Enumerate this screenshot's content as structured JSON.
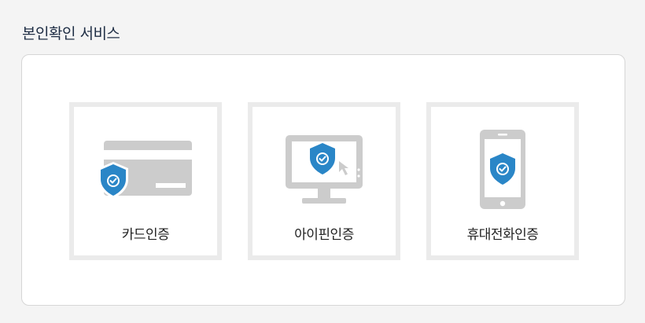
{
  "section": {
    "title": "본인확인 서비스"
  },
  "options": [
    {
      "label": "카드인증",
      "icon": "credit-card-shield-icon"
    },
    {
      "label": "아이핀인증",
      "icon": "monitor-shield-icon"
    },
    {
      "label": "휴대전화인증",
      "icon": "mobile-phone-shield-icon"
    }
  ],
  "colors": {
    "icon_gray": "#cccccc",
    "shield_blue": "#2a86c7",
    "option_border": "#ebebeb",
    "title_text": "#1f2e45"
  }
}
